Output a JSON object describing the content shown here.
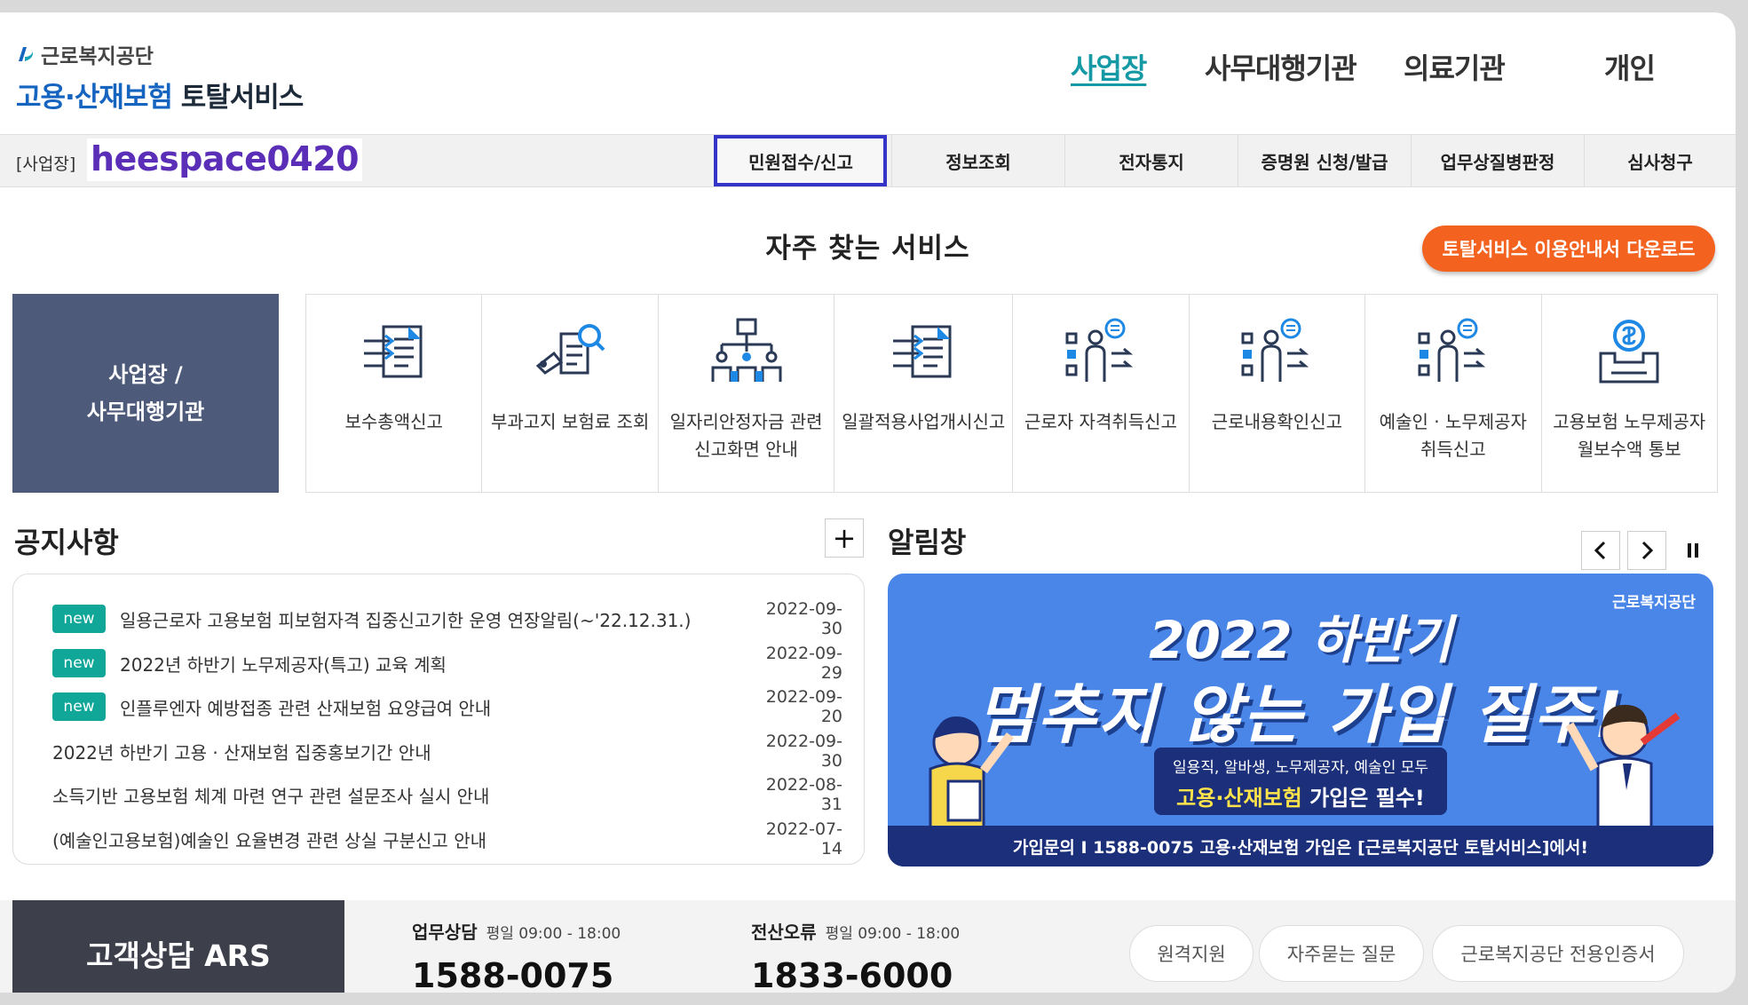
{
  "brand": {
    "org": "근로복지공단",
    "service_blue": "고용·산재보험",
    "service_dark": "토탈서비스"
  },
  "top_nav": [
    "사업장",
    "사무대행기관",
    "의료기관",
    "개인"
  ],
  "sub_bar": {
    "crumb": "[사업장]",
    "user": "heespace0420",
    "menu": [
      "민원접수/신고",
      "정보조회",
      "전자통지",
      "증명원 신청/발급",
      "업무상질병판정",
      "심사청구"
    ]
  },
  "quick": {
    "title": "자주 찾는 서비스",
    "guide_button": "토탈서비스 이용안내서 다운로드",
    "side_panel": [
      "사업장 /",
      "사무대행기관"
    ],
    "items": [
      {
        "label": "보수총액신고",
        "icon": "document-arrows-icon"
      },
      {
        "label": "부과고지 보험료 조회",
        "icon": "document-search-icon"
      },
      {
        "label": "일자리안정자금 관련 신고화면 안내",
        "icon": "organization-chart-icon"
      },
      {
        "label": "일괄적용사업개시신고",
        "icon": "document-arrows-icon"
      },
      {
        "label": "근로자 자격취득신고",
        "icon": "worker-list-icon"
      },
      {
        "label": "근로내용확인신고",
        "icon": "worker-list-icon"
      },
      {
        "label": "예술인 · 노무제공자 취득신고",
        "icon": "worker-list-icon"
      },
      {
        "label": "고용보험 노무제공자 월보수액 통보",
        "icon": "money-box-icon"
      }
    ]
  },
  "notices": {
    "title": "공지사항",
    "more": "+",
    "badge_text": "new",
    "items": [
      {
        "new": true,
        "text": "일용근로자 고용보험 피보험자격 집중신고기한 운영 연장알림(~'22.12.31.)",
        "date": "2022-09-30"
      },
      {
        "new": true,
        "text": "2022년 하반기 노무제공자(특고) 교육 계획",
        "date": "2022-09-29"
      },
      {
        "new": true,
        "text": "인플루엔자 예방접종 관련 산재보험 요양급여 안내",
        "date": "2022-09-20"
      },
      {
        "new": false,
        "text": "2022년 하반기 고용 · 산재보험 집중홍보기간 안내",
        "date": "2022-09-30"
      },
      {
        "new": false,
        "text": "소득기반 고용보험 체계 마련 연구 관련 설문조사 실시 안내",
        "date": "2022-08-31"
      },
      {
        "new": false,
        "text": "(예술인고용보험)예술인 요율변경 관련 상실 구분신고 안내",
        "date": "2022-07-14"
      }
    ]
  },
  "alerts": {
    "title": "알림창",
    "banner": {
      "corp": "근로복지공단",
      "line1": "2022 하반기",
      "line2": "멈추지 않는 가입 질주!",
      "pill_a": "일용직, 알바생, 노무제공자, 예술인 모두",
      "pill_b_yellow": "고용·산재보험",
      "pill_b_rest": " 가입은 필수!",
      "foot": "가입문의 I 1588-0075   고용·산재보험 가입은 [근로복지공단 토탈서비스]에서!"
    }
  },
  "footer": {
    "ars": "고객상담 ARS",
    "contacts": [
      {
        "title": "업무상담",
        "hours": "평일 09:00 - 18:00",
        "number": "1588-0075"
      },
      {
        "title": "전산오류",
        "hours": "평일 09:00 - 18:00",
        "number": "1833-6000"
      }
    ],
    "buttons": [
      "원격지원",
      "자주묻는 질문",
      "근로복지공단 전용인증서"
    ]
  },
  "colors": {
    "accent_teal": "#159aa5",
    "guide_orange": "#f4621f",
    "selected_outline": "#3434c8",
    "badge_green": "#10a799",
    "banner_blue": "#4a86e8"
  }
}
